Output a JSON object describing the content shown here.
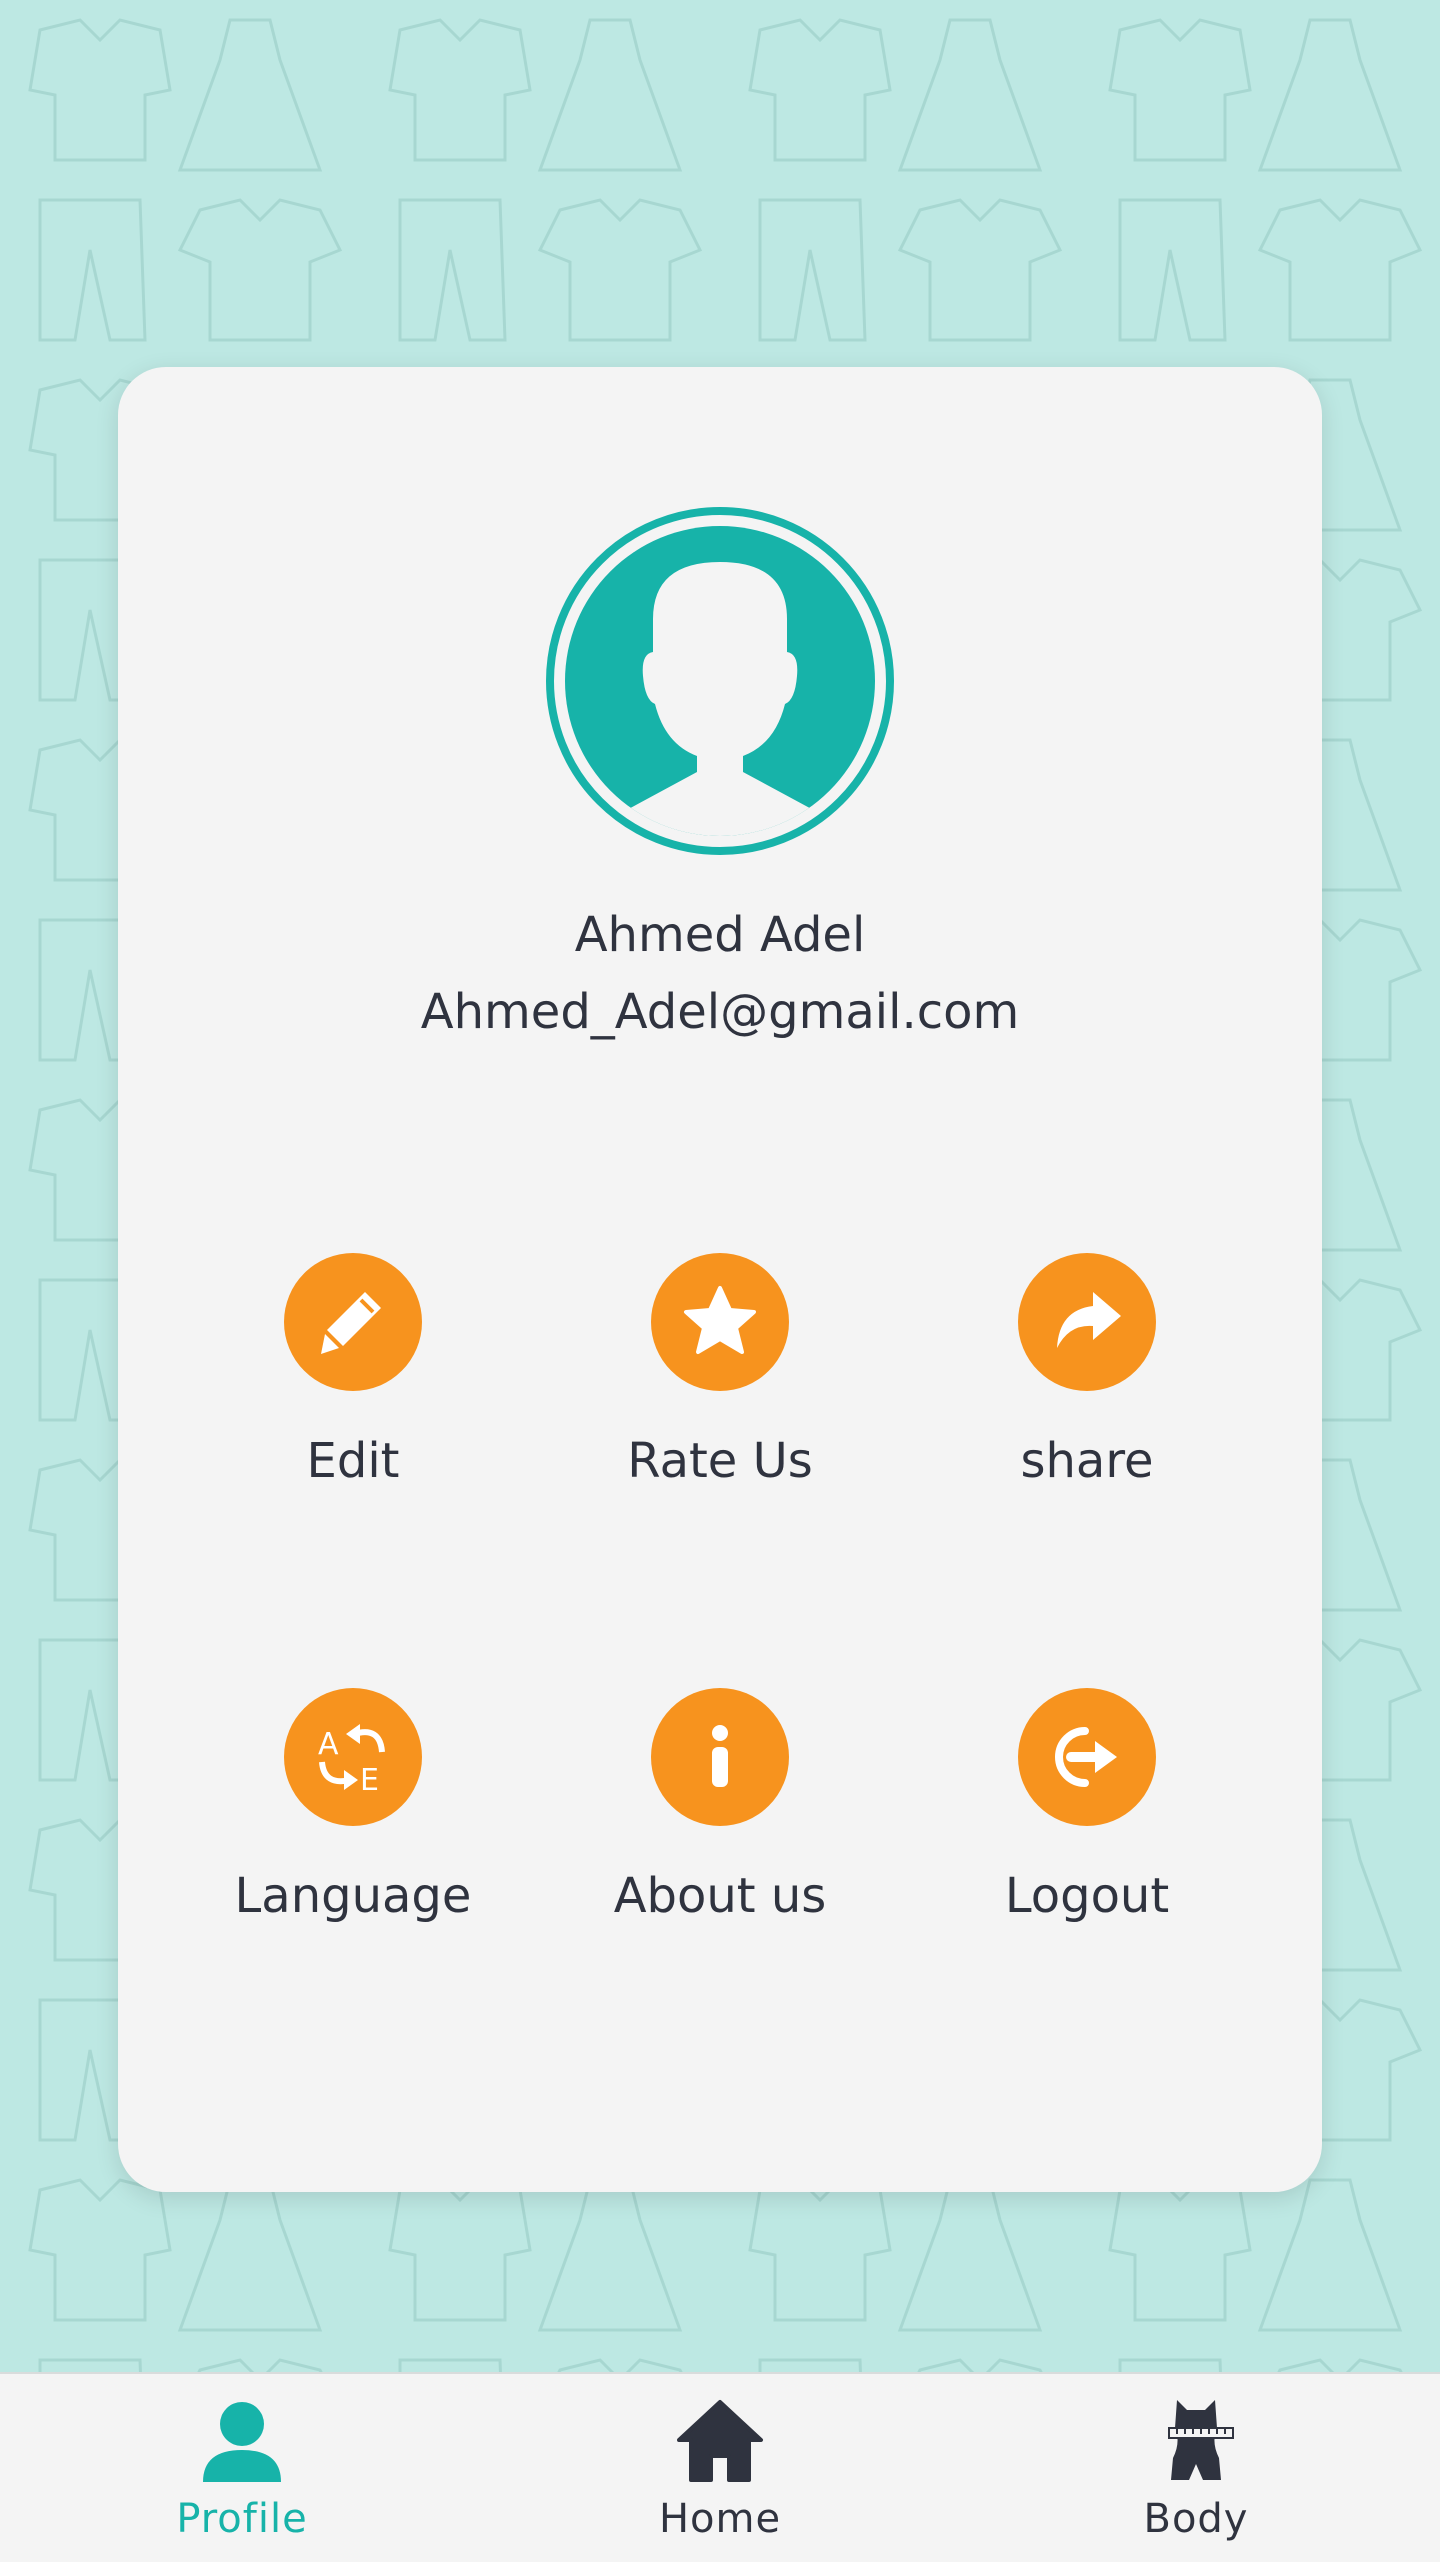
{
  "colors": {
    "background": "#bde8e3",
    "card": "#f4f4f4",
    "accent_teal": "#17b3a9",
    "accent_orange": "#f7931e",
    "text_dark": "#2f333f"
  },
  "profile": {
    "name": "Ahmed Adel",
    "email": "Ahmed_Adel@gmail.com",
    "avatar_icon": "user-avatar-icon"
  },
  "actions": [
    {
      "label": "Edit",
      "icon": "pencil-icon"
    },
    {
      "label": "Rate Us",
      "icon": "star-icon"
    },
    {
      "label": "share",
      "icon": "share-icon"
    },
    {
      "label": "Language",
      "icon": "language-icon"
    },
    {
      "label": "About us",
      "icon": "info-icon"
    },
    {
      "label": "Logout",
      "icon": "logout-icon"
    }
  ],
  "bottom_nav": {
    "items": [
      {
        "label": "Profile",
        "icon": "person-icon",
        "active": true
      },
      {
        "label": "Home",
        "icon": "home-icon",
        "active": false
      },
      {
        "label": "Body",
        "icon": "body-measure-icon",
        "active": false
      }
    ]
  }
}
